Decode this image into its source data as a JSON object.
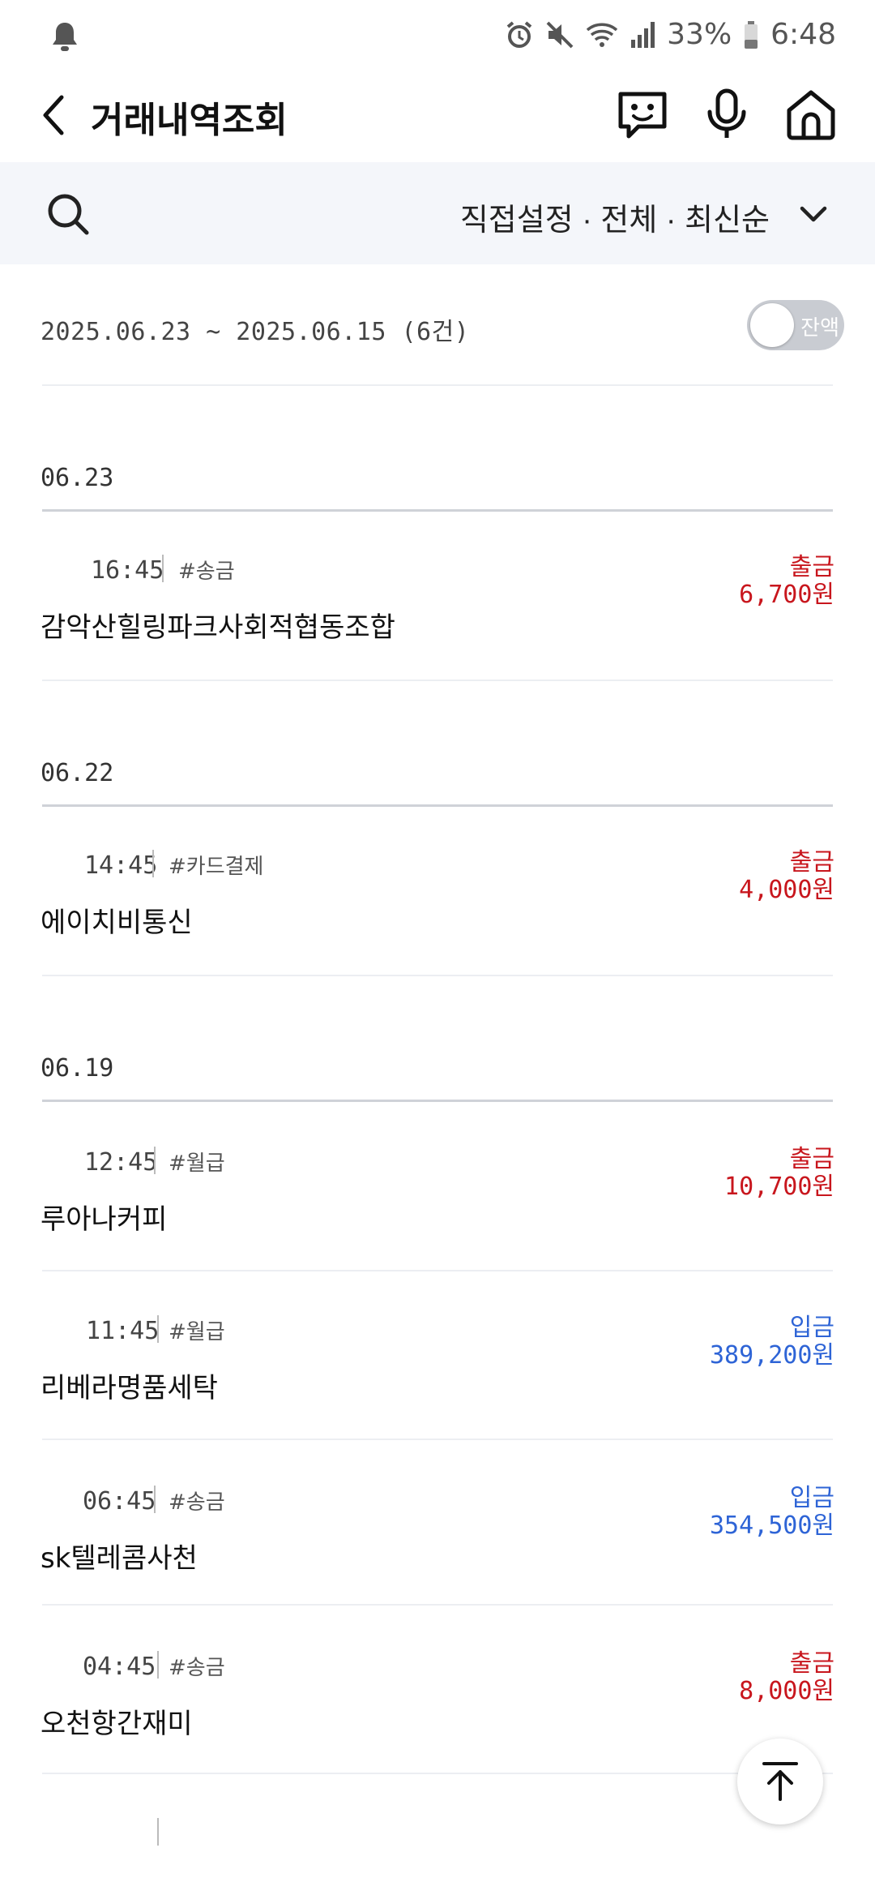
{
  "status": {
    "battery": "33%",
    "time": "6:48"
  },
  "header": {
    "title": "거래내역조회"
  },
  "filter": {
    "label": "직접설정 · 전체 · 최신순"
  },
  "summary": {
    "range": "2025.06.23 ~ 2025.06.15 (6건)",
    "toggle_label": "잔액",
    "toggle_on": false
  },
  "groups": [
    {
      "date": "06.23"
    },
    {
      "date": "06.22"
    },
    {
      "date": "06.19"
    }
  ],
  "transactions": [
    {
      "time": "16:45",
      "tag": "#송금",
      "name": "감악산힐링파크사회적협동조합",
      "type": "출금",
      "amount": "6,700원",
      "direction": "out"
    },
    {
      "time": "14:45",
      "tag": "#카드결제",
      "name": "에이치비통신",
      "type": "출금",
      "amount": "4,000원",
      "direction": "out"
    },
    {
      "time": "12:45",
      "tag": "#월급",
      "name": "루아나커피",
      "type": "출금",
      "amount": "10,700원",
      "direction": "out"
    },
    {
      "time": "11:45",
      "tag": "#월급",
      "name": "리베라명품세탁",
      "type": "입금",
      "amount": "389,200원",
      "direction": "in"
    },
    {
      "time": "06:45",
      "tag": "#송금",
      "name": "sk텔레콤사천",
      "type": "입금",
      "amount": "354,500원",
      "direction": "in"
    },
    {
      "time": "04:45",
      "tag": "#송금",
      "name": "오천항간재미",
      "type": "출금",
      "amount": "8,000원",
      "direction": "out"
    }
  ],
  "colors": {
    "out": "#c8161d",
    "in": "#2e64d6",
    "filter_bg": "#f4f6fa"
  }
}
